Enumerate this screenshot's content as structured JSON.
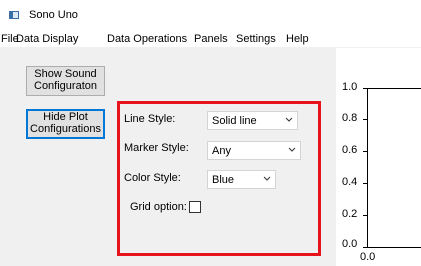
{
  "window": {
    "title": "Sono Uno"
  },
  "menu": [
    "File",
    "Data Display",
    "Data Operations",
    "Panels",
    "Settings",
    "Help"
  ],
  "buttons": {
    "show_sound_line1": "Show Sound",
    "show_sound_line2": "Configuraton",
    "hide_plot_line1": "Hide Plot",
    "hide_plot_line2": "Configurations"
  },
  "plot_config": {
    "line_style_label": "Line Style:",
    "line_style_value": "Solid line",
    "marker_style_label": "Marker Style:",
    "marker_style_value": "Any",
    "color_style_label": "Color Style:",
    "color_style_value": "Blue",
    "grid_label": "Grid option:",
    "grid_checked": false,
    "highlight_color": "#e8121c"
  },
  "plot": {
    "y_ticks": [
      "1.0",
      "0.8",
      "0.6",
      "0.4",
      "0.2",
      "0.0"
    ],
    "x_ticks": [
      "0.0"
    ]
  },
  "icons": {
    "app": "window-icon",
    "dropdown": "chevron-down-icon"
  }
}
